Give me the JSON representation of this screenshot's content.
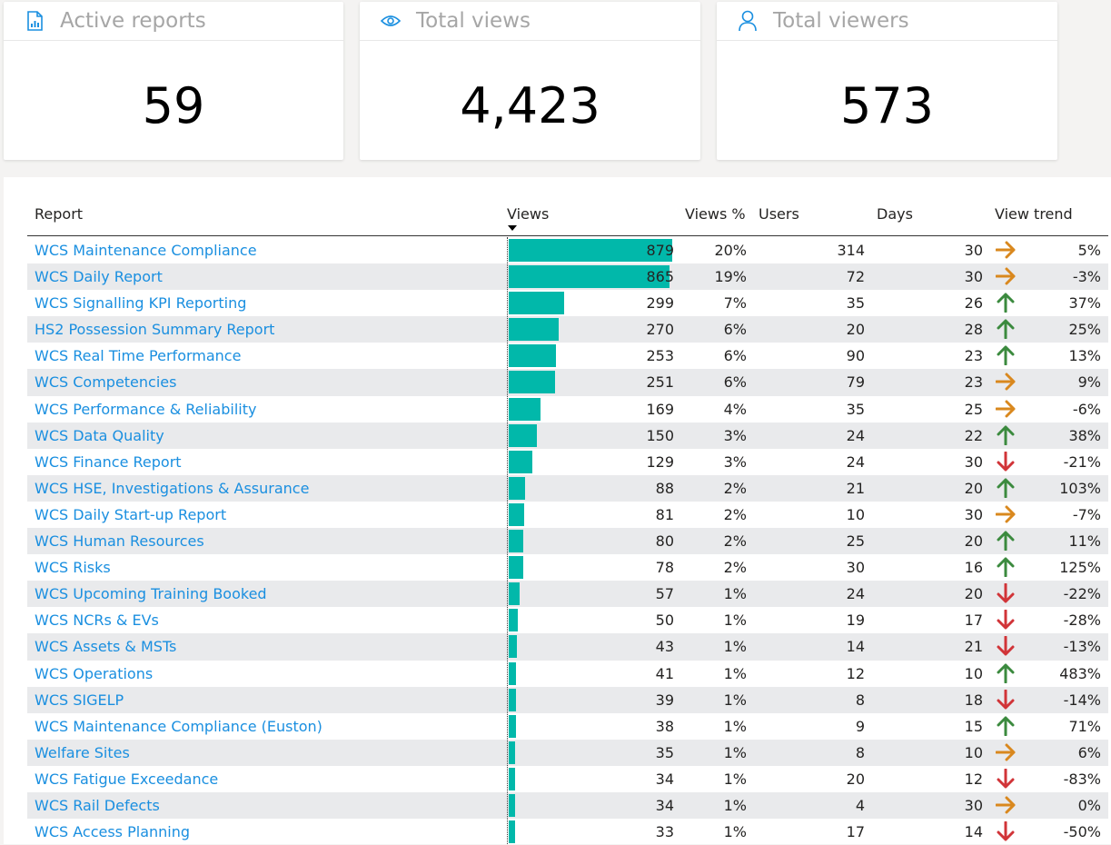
{
  "cards": [
    {
      "title": "Active reports",
      "value": "59",
      "icon": "report-icon"
    },
    {
      "title": "Total views",
      "value": "4,423",
      "icon": "eye-icon"
    },
    {
      "title": "Total viewers",
      "value": "573",
      "icon": "person-icon"
    }
  ],
  "table": {
    "headers": {
      "report": "Report",
      "views": "Views",
      "views_pct": "Views %",
      "users": "Users",
      "days": "Days",
      "view_trend": "View trend"
    },
    "max_views": 879,
    "rows": [
      {
        "report": "WCS Maintenance Compliance",
        "views": "879",
        "pct": "20%",
        "users": "314",
        "days": "30",
        "trend": "flat",
        "trend_val": "5%"
      },
      {
        "report": "WCS Daily Report",
        "views": "865",
        "pct": "19%",
        "users": "72",
        "days": "30",
        "trend": "flat",
        "trend_val": "-3%"
      },
      {
        "report": "WCS Signalling KPI Reporting",
        "views": "299",
        "pct": "7%",
        "users": "35",
        "days": "26",
        "trend": "up",
        "trend_val": "37%"
      },
      {
        "report": "HS2 Possession Summary Report",
        "views": "270",
        "pct": "6%",
        "users": "20",
        "days": "28",
        "trend": "up",
        "trend_val": "25%"
      },
      {
        "report": "WCS Real Time Performance",
        "views": "253",
        "pct": "6%",
        "users": "90",
        "days": "23",
        "trend": "up",
        "trend_val": "13%"
      },
      {
        "report": "WCS Competencies",
        "views": "251",
        "pct": "6%",
        "users": "79",
        "days": "23",
        "trend": "flat",
        "trend_val": "9%"
      },
      {
        "report": "WCS Performance & Reliability",
        "views": "169",
        "pct": "4%",
        "users": "35",
        "days": "25",
        "trend": "flat",
        "trend_val": "-6%"
      },
      {
        "report": "WCS Data Quality",
        "views": "150",
        "pct": "3%",
        "users": "24",
        "days": "22",
        "trend": "up",
        "trend_val": "38%"
      },
      {
        "report": "WCS Finance Report",
        "views": "129",
        "pct": "3%",
        "users": "24",
        "days": "30",
        "trend": "down",
        "trend_val": "-21%"
      },
      {
        "report": "WCS HSE, Investigations & Assurance",
        "views": "88",
        "pct": "2%",
        "users": "21",
        "days": "20",
        "trend": "up",
        "trend_val": "103%"
      },
      {
        "report": "WCS Daily Start-up Report",
        "views": "81",
        "pct": "2%",
        "users": "10",
        "days": "30",
        "trend": "flat",
        "trend_val": "-7%"
      },
      {
        "report": "WCS Human Resources",
        "views": "80",
        "pct": "2%",
        "users": "25",
        "days": "20",
        "trend": "up",
        "trend_val": "11%"
      },
      {
        "report": "WCS Risks",
        "views": "78",
        "pct": "2%",
        "users": "30",
        "days": "16",
        "trend": "up",
        "trend_val": "125%"
      },
      {
        "report": "WCS Upcoming Training Booked",
        "views": "57",
        "pct": "1%",
        "users": "24",
        "days": "20",
        "trend": "down",
        "trend_val": "-22%"
      },
      {
        "report": "WCS NCRs & EVs",
        "views": "50",
        "pct": "1%",
        "users": "19",
        "days": "17",
        "trend": "down",
        "trend_val": "-28%"
      },
      {
        "report": "WCS Assets & MSTs",
        "views": "43",
        "pct": "1%",
        "users": "14",
        "days": "21",
        "trend": "down",
        "trend_val": "-13%"
      },
      {
        "report": "WCS Operations",
        "views": "41",
        "pct": "1%",
        "users": "12",
        "days": "10",
        "trend": "up",
        "trend_val": "483%"
      },
      {
        "report": "WCS SIGELP",
        "views": "39",
        "pct": "1%",
        "users": "8",
        "days": "18",
        "trend": "down",
        "trend_val": "-14%"
      },
      {
        "report": "WCS Maintenance Compliance (Euston)",
        "views": "38",
        "pct": "1%",
        "users": "9",
        "days": "15",
        "trend": "up",
        "trend_val": "71%"
      },
      {
        "report": "Welfare Sites",
        "views": "35",
        "pct": "1%",
        "users": "8",
        "days": "10",
        "trend": "flat",
        "trend_val": "6%"
      },
      {
        "report": "WCS Fatigue Exceedance",
        "views": "34",
        "pct": "1%",
        "users": "20",
        "days": "12",
        "trend": "down",
        "trend_val": "-83%"
      },
      {
        "report": "WCS Rail Defects",
        "views": "34",
        "pct": "1%",
        "users": "4",
        "days": "30",
        "trend": "flat",
        "trend_val": "0%"
      },
      {
        "report": "WCS Access Planning",
        "views": "33",
        "pct": "1%",
        "users": "17",
        "days": "14",
        "trend": "down",
        "trend_val": "-50%"
      }
    ]
  },
  "colors": {
    "bar": "#01b8aa",
    "link": "#1a8fe0",
    "up": "#3b8a3e",
    "down": "#d13438",
    "flat": "#d9881e",
    "icon": "#1a8fe0"
  }
}
